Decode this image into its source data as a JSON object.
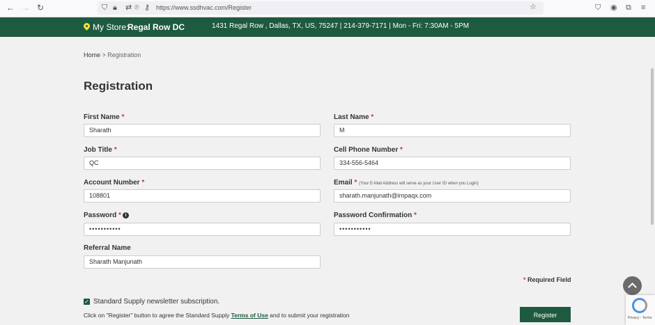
{
  "browser": {
    "url": "https://www.ssdhvac.com/Register"
  },
  "store": {
    "label": "My Store:",
    "name": "Regal Row DC",
    "info": "1431 Regal Row , Dallas, TX, US, 75247 | 214-379-7171 | Mon - Fri: 7:30AM - 5PM"
  },
  "breadcrumb": {
    "home": "Home",
    "separator": " > ",
    "current": "Registration"
  },
  "page_title": "Registration",
  "form": {
    "first_name": {
      "label": "First Name",
      "required_mark": "*",
      "value": "Sharath"
    },
    "last_name": {
      "label": "Last Name",
      "required_mark": "*",
      "value": "M"
    },
    "job_title": {
      "label": "Job Title",
      "required_mark": "*",
      "value": "QC"
    },
    "cell_phone": {
      "label": "Cell Phone Number",
      "required_mark": "*",
      "value": "334-556-5464"
    },
    "account_number": {
      "label": "Account Number",
      "required_mark": "*",
      "value": "108801"
    },
    "email": {
      "label": "Email",
      "required_mark": "*",
      "note": "(Your E-Mail Address will serve as your User ID when you Login)",
      "value": "sharath.manjunath@impaqx.com"
    },
    "password": {
      "label": "Password",
      "required_mark": "*",
      "value": "•••••••••••"
    },
    "password_confirm": {
      "label": "Password Confirmation",
      "required_mark": "*",
      "value": "•••••••••••"
    },
    "referral": {
      "label": "Referral Name",
      "value": "Sharath Manjunath"
    }
  },
  "required_field_note": {
    "mark": "*",
    "text": "Required Field"
  },
  "newsletter": {
    "checked": true,
    "label": "Standard Supply newsletter subscription."
  },
  "terms": {
    "before": "Click on \"Register\" button to agree the Standard Supply ",
    "link": "Terms of Use",
    "after": " and to submit your registration"
  },
  "register_button": "Register",
  "recaptcha": {
    "text": "Privacy - Terms"
  },
  "colors": {
    "brand": "#1e5a3f",
    "pin": "#f4e23a",
    "required": "#c0392b"
  }
}
